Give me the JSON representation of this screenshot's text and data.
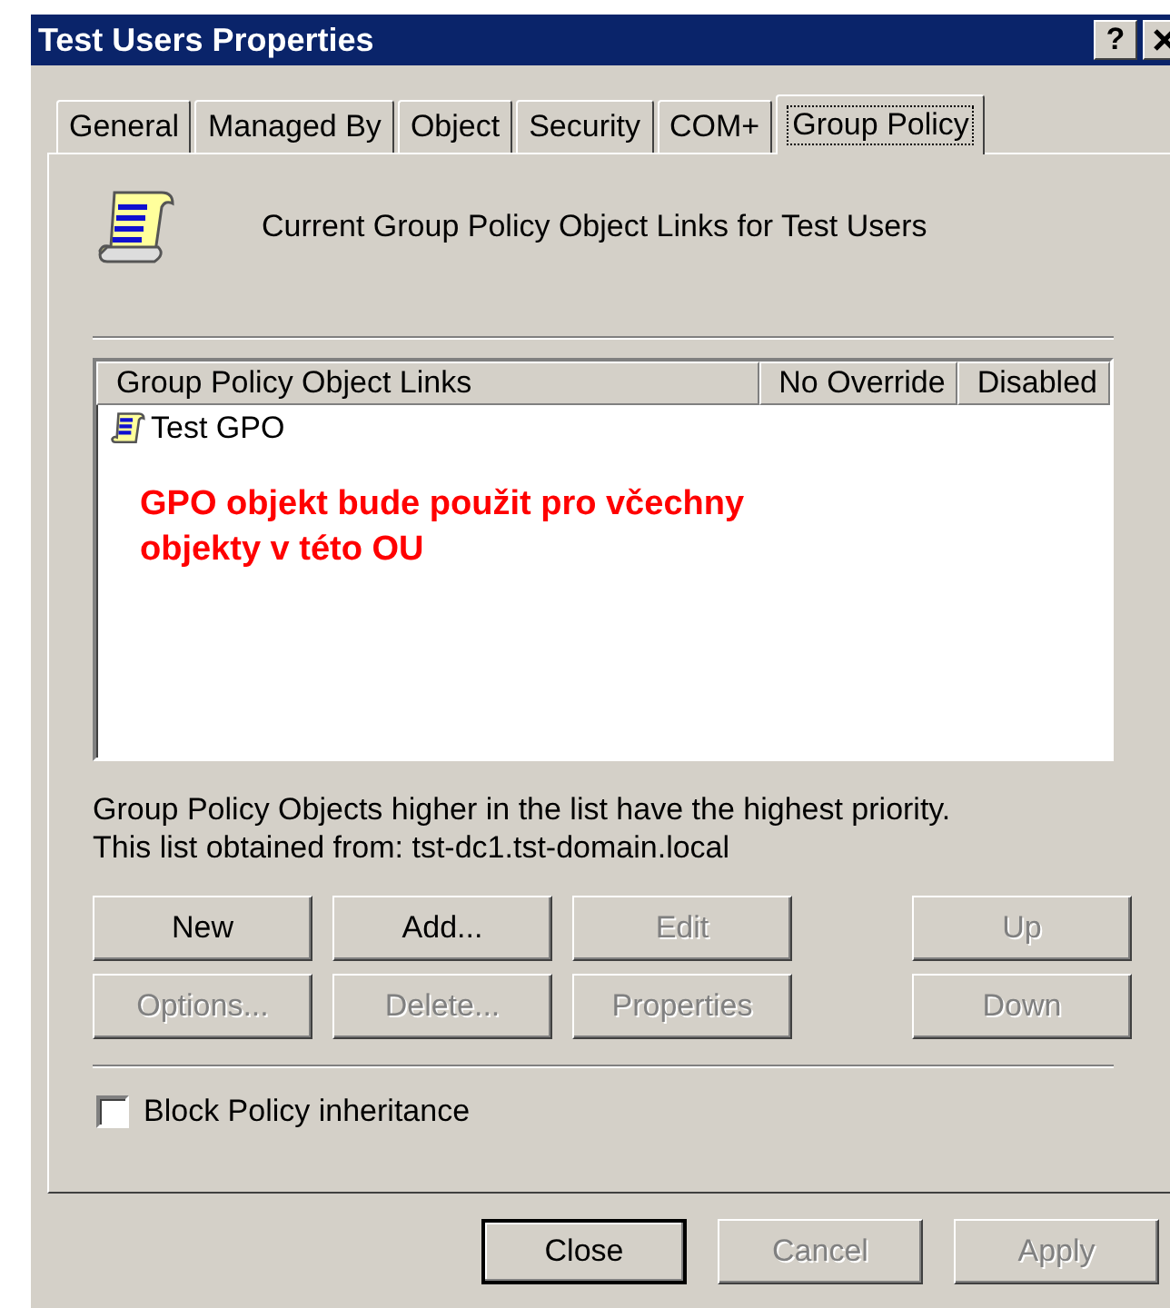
{
  "window": {
    "title": "Test Users Properties",
    "help_button": "?"
  },
  "tabs": [
    {
      "label": "General",
      "selected": false
    },
    {
      "label": "Managed By",
      "selected": false
    },
    {
      "label": "Object",
      "selected": false
    },
    {
      "label": "Security",
      "selected": false
    },
    {
      "label": "COM+",
      "selected": false
    },
    {
      "label": "Group Policy",
      "selected": true
    }
  ],
  "header": "Current Group Policy Object Links for Test Users",
  "table": {
    "columns": [
      "Group Policy Object Links",
      "No Override",
      "Disabled"
    ],
    "rows": [
      {
        "name": "Test GPO",
        "selected": false
      }
    ]
  },
  "annotation": "GPO objekt bude použit pro včechny objekty v této OU",
  "notes": [
    "Group Policy Objects higher in the list have the highest priority.",
    "This list obtained from: tst-dc1.tst-domain.local"
  ],
  "buttons": [
    [
      {
        "label": "New",
        "disabled": false
      },
      {
        "label": "Add...",
        "disabled": false
      },
      {
        "label": "Edit",
        "disabled": true
      },
      {
        "label": "Up",
        "disabled": true
      }
    ],
    [
      {
        "label": "Options...",
        "disabled": true
      },
      {
        "label": "Delete...",
        "disabled": true
      },
      {
        "label": "Properties",
        "disabled": true
      },
      {
        "label": "Down",
        "disabled": true
      }
    ]
  ],
  "block_inheritance": {
    "label": "Block Policy inheritance",
    "checked": false
  },
  "dialog_buttons": [
    {
      "label": "Close",
      "disabled": false,
      "default": true
    },
    {
      "label": "Cancel",
      "disabled": true,
      "default": false
    },
    {
      "label": "Apply",
      "disabled": true,
      "default": false
    }
  ]
}
